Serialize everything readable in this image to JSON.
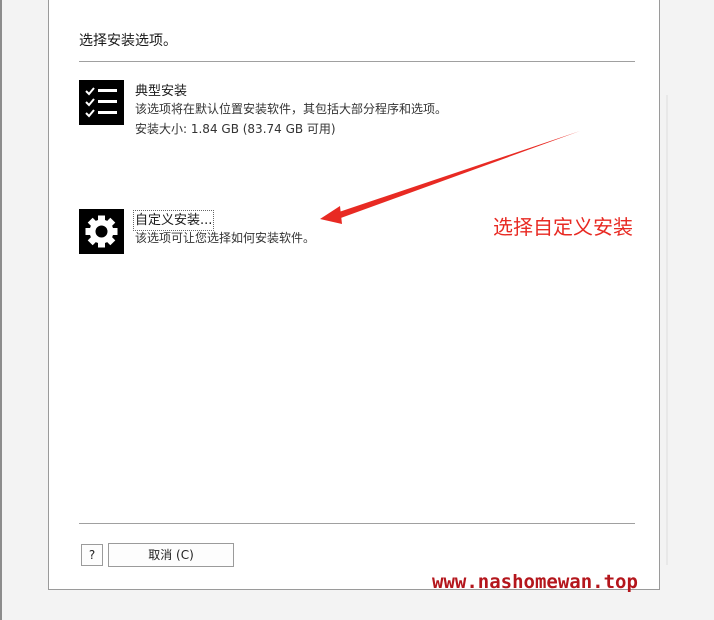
{
  "dialog": {
    "heading": "选择安装选项。",
    "options": [
      {
        "title": "典型安装",
        "description": "该选项将在默认位置安装软件，其包括大部分程序和选项。",
        "size": "安装大小: 1.84 GB (83.74 GB 可用)",
        "icon": "checklist-icon"
      },
      {
        "title": "自定义安装...",
        "description": "该选项可让您选择如何安装软件。",
        "icon": "gear-icon"
      }
    ],
    "help_label": "?",
    "cancel_label": "取消 (C)"
  },
  "annotation": {
    "text": "选择自定义安装",
    "color": "#e82a23"
  },
  "watermark": "www.nashomewan.top"
}
